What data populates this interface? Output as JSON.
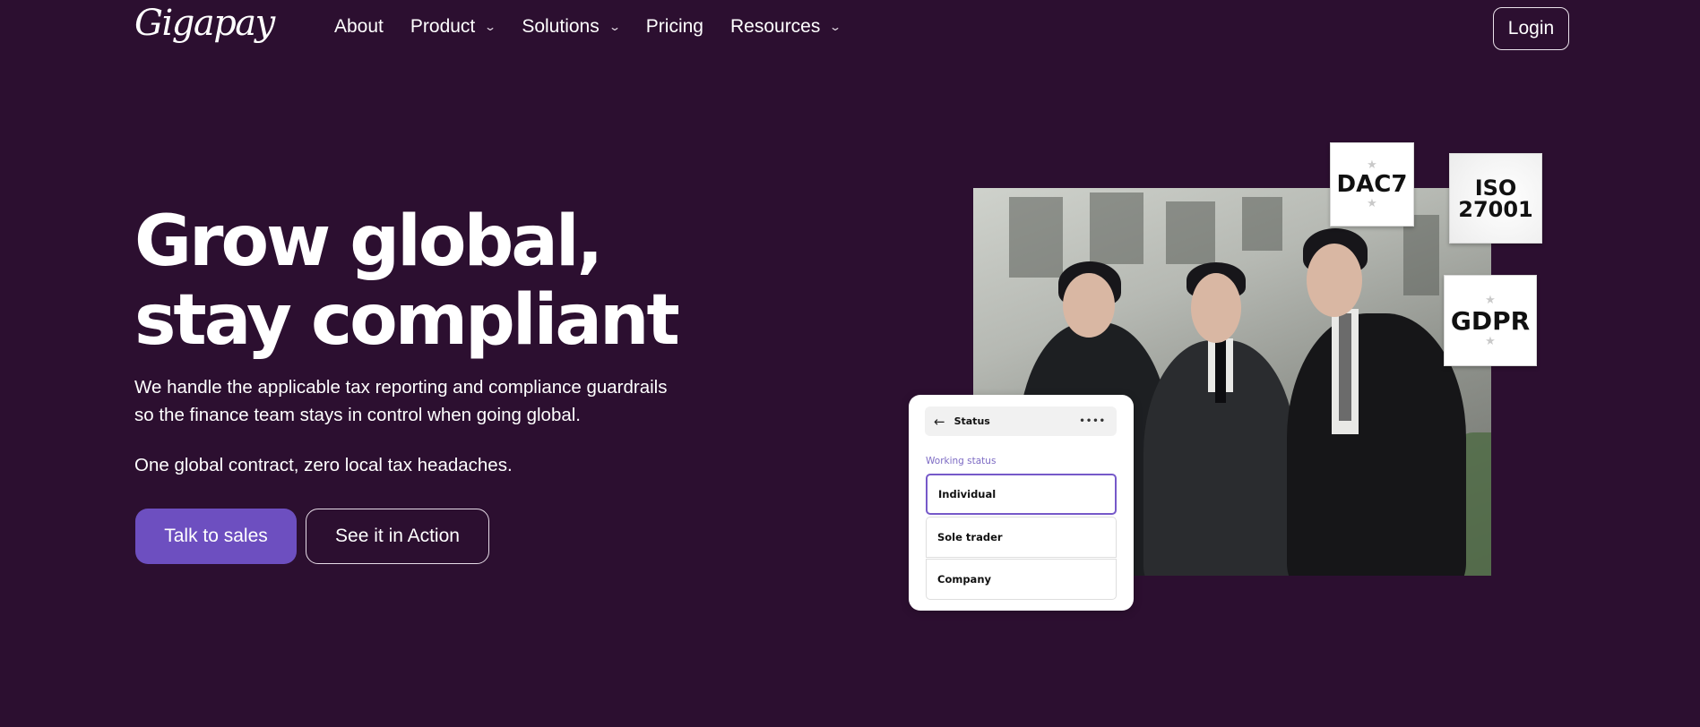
{
  "header": {
    "logo": "Gigapay",
    "nav": [
      {
        "label": "About",
        "has_dropdown": false
      },
      {
        "label": "Product",
        "has_dropdown": true
      },
      {
        "label": "Solutions",
        "has_dropdown": true
      },
      {
        "label": "Pricing",
        "has_dropdown": false
      },
      {
        "label": "Resources",
        "has_dropdown": true
      }
    ],
    "login_label": "Login"
  },
  "hero": {
    "headline_line1": "Grow global,",
    "headline_line2": "stay compliant",
    "subtext_line1": "We handle the applicable tax reporting and compliance guardrails",
    "subtext_line2": "so the finance team stays in control when going global.",
    "tagline": "One global contract, zero local tax headaches.",
    "primary_cta": "Talk to sales",
    "secondary_cta": "See it in Action"
  },
  "badges": {
    "dac7": "DAC7",
    "iso_line1": "ISO",
    "iso_line2": "27001",
    "gdpr": "GDPR"
  },
  "status_card": {
    "title": "Status",
    "label": "Working status",
    "options": [
      "Individual",
      "Sole trader",
      "Company"
    ],
    "selected": "Individual"
  },
  "colors": {
    "background": "#2c0f30",
    "accent": "#6d4fc0",
    "card_label": "#7d6bc4"
  }
}
